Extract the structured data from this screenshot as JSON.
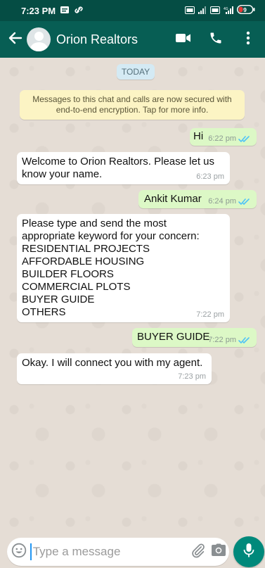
{
  "status_bar": {
    "time": "7:23 PM",
    "battery": "9"
  },
  "header": {
    "contact_name": "Orion Realtors"
  },
  "chat": {
    "date_chip": "TODAY",
    "encryption_notice": "Messages to this chat and calls are now secured with end-to-end encryption. Tap for more info.",
    "messages": [
      {
        "direction": "out",
        "text": "Hi",
        "time": "6:22 pm",
        "read": true
      },
      {
        "direction": "in",
        "text": "Welcome to Orion Realtors. Please let us know your name.",
        "time": "6:23 pm"
      },
      {
        "direction": "out",
        "text": "Ankit Kumar",
        "time": "6:24 pm",
        "read": true
      },
      {
        "direction": "in",
        "text": "Please type and send the most appropriate keyword for your concern:\nRESIDENTIAL PROJECTS\nAFFORDABLE HOUSING\nBUILDER FLOORS\nCOMMERCIAL PLOTS\nBUYER GUIDE\nOTHERS",
        "time": "7:22 pm"
      },
      {
        "direction": "out",
        "text": "BUYER GUIDE",
        "time": "7:22 pm",
        "read": true
      },
      {
        "direction": "in",
        "text": "Okay. I will connect you with my agent.",
        "time": "7:23 pm"
      }
    ]
  },
  "composer": {
    "placeholder": "Type a message"
  },
  "colors": {
    "header": "#075e54",
    "status_bar": "#054d44",
    "outgoing_bubble": "#dcf8c6",
    "incoming_bubble": "#ffffff",
    "read_ticks": "#4fc3f7",
    "mic_button": "#00897b"
  },
  "icons": [
    "back-arrow-icon",
    "video-call-icon",
    "phone-call-icon",
    "more-options-icon",
    "emoji-icon",
    "attach-icon",
    "camera-icon",
    "mic-icon",
    "read-receipt-icon"
  ]
}
